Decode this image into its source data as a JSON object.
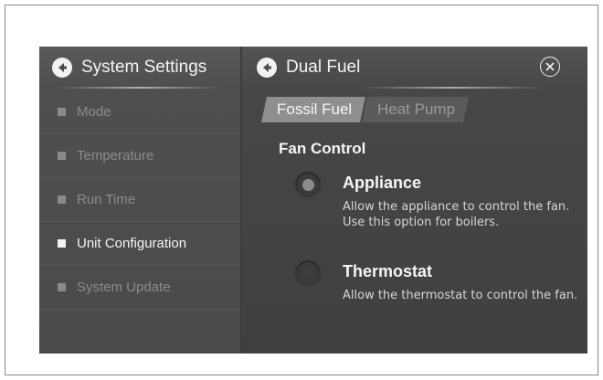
{
  "sidebar": {
    "title": "System Settings",
    "items": [
      {
        "label": "Mode",
        "active": false
      },
      {
        "label": "Temperature",
        "active": false
      },
      {
        "label": "Run Time",
        "active": false
      },
      {
        "label": "Unit Configuration",
        "active": true
      },
      {
        "label": "System Update",
        "active": false
      }
    ]
  },
  "header": {
    "title": "Dual Fuel"
  },
  "tabs": [
    {
      "label": "Fossil Fuel",
      "active": true
    },
    {
      "label": "Heat Pump",
      "active": false
    }
  ],
  "section": {
    "title": "Fan Control"
  },
  "options": [
    {
      "label": "Appliance",
      "description": "Allow the appliance to control the fan. Use this option for boilers.",
      "selected": true
    },
    {
      "label": "Thermostat",
      "description": "Allow the thermostat to control the fan.",
      "selected": false
    }
  ],
  "colors": {
    "active_text": "#f5f5f5",
    "inactive_text": "#8c8c8c",
    "panel": "#4a4a4a",
    "active_tab": "#8f8f8f"
  }
}
